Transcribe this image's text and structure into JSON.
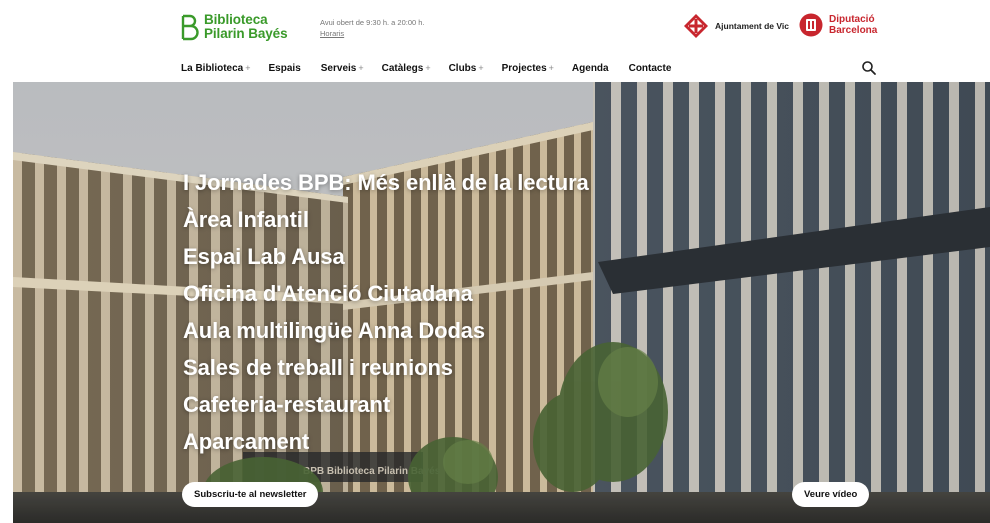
{
  "brand": {
    "line1": "Biblioteca",
    "line2": "Pilarin Bayés",
    "color": "#3a9a2a"
  },
  "hours": {
    "text": "Avui obert de 9:30 h. a 20:00 h.",
    "link": "Horaris"
  },
  "partners": {
    "vic": "Ajuntament de Vic",
    "diputacio_line1": "Diputació",
    "diputacio_line2": "Barcelona",
    "diputacio_color": "#c8262e"
  },
  "nav": [
    {
      "label": "La Biblioteca",
      "expandable": "+"
    },
    {
      "label": "Espais",
      "expandable": ""
    },
    {
      "label": "Serveis",
      "expandable": "+"
    },
    {
      "label": "Catàlegs",
      "expandable": "+"
    },
    {
      "label": "Clubs",
      "expandable": "+"
    },
    {
      "label": "Projectes",
      "expandable": "+"
    },
    {
      "label": "Agenda",
      "expandable": ""
    },
    {
      "label": "Contacte",
      "expandable": ""
    }
  ],
  "hero": {
    "links": [
      "I Jornades BPB: Més enllà de la lectura",
      "Àrea Infantil",
      "Espai Lab Ausa",
      "Oficina d'Atenció Ciutadana",
      "Aula multilingüe Anna Dodas",
      "Sales de treball i reunions",
      "Cafeteria-restaurant",
      "Aparcament"
    ],
    "newsletter_button": "Subscriu-te al newsletter",
    "video_button": "Veure vídeo",
    "signage": "BPB Biblioteca Pilarin Bayés"
  },
  "icons": {
    "search": "search-icon",
    "logo": "library-logo-icon",
    "vic": "vic-shield-icon",
    "diputacio": "diputacio-seal-icon"
  }
}
